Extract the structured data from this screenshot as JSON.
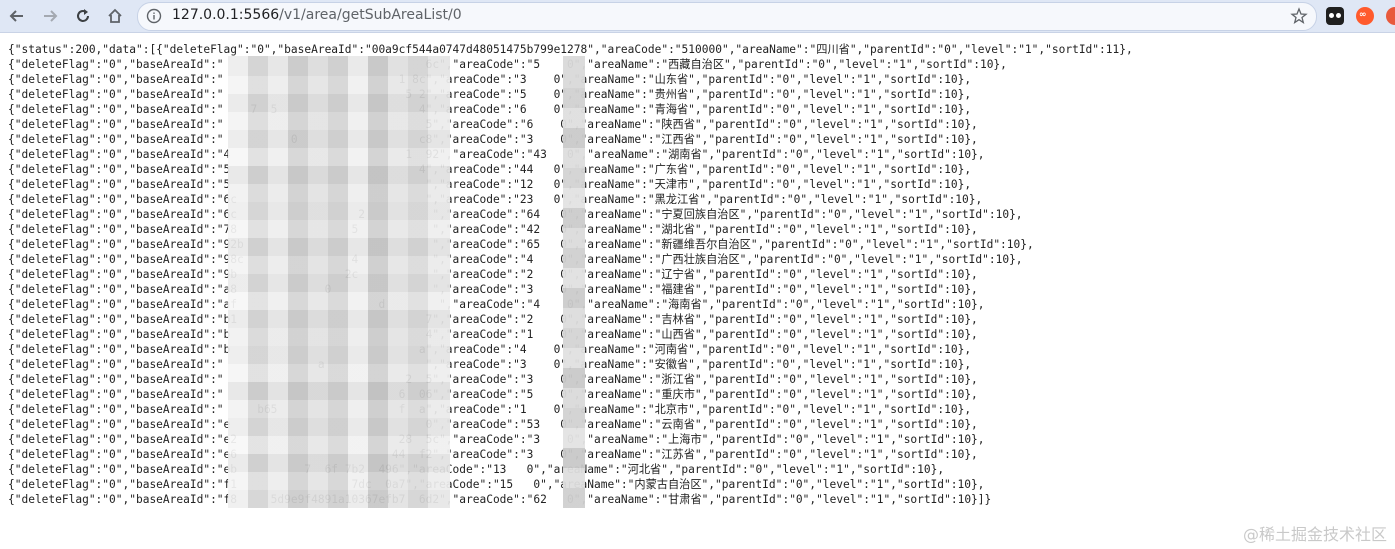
{
  "browser": {
    "url_host": "127.0.0.1:5566",
    "url_path": "/v1/area/getSubAreaList/0"
  },
  "response_lines": [
    "{\"status\":200,\"data\":[{\"deleteFlag\":\"0\",\"baseAreaId\":\"00a9cf544a0747d48051475b799e1278\",\"areaCode\":\"510000\",\"areaName\":\"四川省\",\"parentId\":\"0\",\"level\":\"1\",\"sortId\":11},",
    "{\"deleteFlag\":\"0\",\"baseAreaId\":\"                              6c\",\"areaCode\":\"5    0\",\"areaName\":\"西藏自治区\",\"parentId\":\"0\",\"level\":\"1\",\"sortId\":10},",
    "{\"deleteFlag\":\"0\",\"baseAreaId\":\"                          1 8c\",\"areaCode\":\"3    0\",\"areaName\":\"山东省\",\"parentId\":\"0\",\"level\":\"1\",\"sortId\":10},",
    "{\"deleteFlag\":\"0\",\"baseAreaId\":\"                           5 2\",\"areaCode\":\"5    0\",\"areaName\":\"贵州省\",\"parentId\":\"0\",\"level\":\"1\",\"sortId\":10},",
    "{\"deleteFlag\":\"0\",\"baseAreaId\":\"    7  5                     4\",\"areaCode\":\"6    0\",\"areaName\":\"青海省\",\"parentId\":\"0\",\"level\":\"1\",\"sortId\":10},",
    "{\"deleteFlag\":\"0\",\"baseAreaId\":\"                              5\",\"areaCode\":\"6    0\",\"areaName\":\"陕西省\",\"parentId\":\"0\",\"level\":\"1\",\"sortId\":10},",
    "{\"deleteFlag\":\"0\",\"baseAreaId\":\"          0                  c8\",\"areaCode\":\"3    0\",\"areaName\":\"江西省\",\"parentId\":\"0\",\"level\":\"1\",\"sortId\":10},",
    "{\"deleteFlag\":\"0\",\"baseAreaId\":\"4                          1  92\",\"areaCode\":\"43   0\",\"areaName\":\"湖南省\",\"parentId\":\"0\",\"level\":\"1\",\"sortId\":10},",
    "{\"deleteFlag\":\"0\",\"baseAreaId\":\"5                            4\",\"areaCode\":\"44   0\",\"areaName\":\"广东省\",\"parentId\":\"0\",\"level\":\"1\",\"sortId\":10},",
    "{\"deleteFlag\":\"0\",\"baseAreaId\":\"5                             \",\"areaCode\":\"12   0\",\"areaName\":\"天津市\",\"parentId\":\"0\",\"level\":\"1\",\"sortId\":10},",
    "{\"deleteFlag\":\"0\",\"baseAreaId\":\"6c                            \",\"areaCode\":\"23   0\",\"areaName\":\"黑龙江省\",\"parentId\":\"0\",\"level\":\"1\",\"sortId\":10},",
    "{\"deleteFlag\":\"0\",\"baseAreaId\":\"6c                  2          \",\"areaCode\":\"64   0\",\"areaName\":\"宁夏回族自治区\",\"parentId\":\"0\",\"level\":\"1\",\"sortId\":10},",
    "{\"deleteFlag\":\"0\",\"baseAreaId\":\"78                 5           \",\"areaCode\":\"42   0\",\"areaName\":\"湖北省\",\"parentId\":\"0\",\"level\":\"1\",\"sortId\":10},",
    "{\"deleteFlag\":\"0\",\"baseAreaId\":\"92b                            \",\"areaCode\":\"65   0\",\"areaName\":\"新疆维吾尔自治区\",\"parentId\":\"0\",\"level\":\"1\",\"sortId\":10},",
    "{\"deleteFlag\":\"0\",\"baseAreaId\":\"98c                4           \",\"areaCode\":\"4    0\",\"areaName\":\"广西壮族自治区\",\"parentId\":\"0\",\"level\":\"1\",\"sortId\":10},",
    "{\"deleteFlag\":\"0\",\"baseAreaId\":\"9b                2c           \",\"areaCode\":\"2    0\",\"areaName\":\"辽宁省\",\"parentId\":\"0\",\"level\":\"1\",\"sortId\":10},",
    "{\"deleteFlag\":\"0\",\"baseAreaId\":\"a8             0               \",\"areaCode\":\"3    0\",\"areaName\":\"福建省\",\"parentId\":\"0\",\"level\":\"1\",\"sortId\":10},",
    "{\"deleteFlag\":\"0\",\"baseAreaId\":\"af                     d        \",\"areaCode\":\"4    0\",\"areaName\":\"海南省\",\"parentId\":\"0\",\"level\":\"1\",\"sortId\":10},",
    "{\"deleteFlag\":\"0\",\"baseAreaId\":\"b1                            7\",\"areaCode\":\"2    0\",\"areaName\":\"吉林省\",\"parentId\":\"0\",\"level\":\"1\",\"sortId\":10},",
    "{\"deleteFlag\":\"0\",\"baseAreaId\":\"b                             4\",\"areaCode\":\"1    0\",\"areaName\":\"山西省\",\"parentId\":\"0\",\"level\":\"1\",\"sortId\":10},",
    "{\"deleteFlag\":\"0\",\"baseAreaId\":\"b                            a\",\"areaCode\":\"4    0\",\"areaName\":\"河南省\",\"parentId\":\"0\",\"level\":\"1\",\"sortId\":10},",
    "{\"deleteFlag\":\"0\",\"baseAreaId\":\"              a               \",\"areaCode\":\"3    0\",\"areaName\":\"安徽省\",\"parentId\":\"0\",\"level\":\"1\",\"sortId\":10},",
    "{\"deleteFlag\":\"0\",\"baseAreaId\":\"                           2  5\",\"areaCode\":\"3    0\",\"areaName\":\"浙江省\",\"parentId\":\"0\",\"level\":\"1\",\"sortId\":10},",
    "{\"deleteFlag\":\"0\",\"baseAreaId\":\"                          6  06\",\"areaCode\":\"5    0\",\"areaName\":\"重庆市\",\"parentId\":\"0\",\"level\":\"1\",\"sortId\":10},",
    "{\"deleteFlag\":\"0\",\"baseAreaId\":\"     b65                  f  a\",\"areaCode\":\"1    0\",\"areaName\":\"北京市\",\"parentId\":\"0\",\"level\":\"1\",\"sortId\":10},",
    "{\"deleteFlag\":\"0\",\"baseAreaId\":\"e                             0\",\"areaCode\":\"53   0\",\"areaName\":\"云南省\",\"parentId\":\"0\",\"level\":\"1\",\"sortId\":10},",
    "{\"deleteFlag\":\"0\",\"baseAreaId\":\"e2                        28  5c\",\"areaCode\":\"3    0\",\"areaName\":\"上海市\",\"parentId\":\"0\",\"level\":\"1\",\"sortId\":10},",
    "{\"deleteFlag\":\"0\",\"baseAreaId\":\"e6                       44  f2\",\"areaCode\":\"3    0\",\"areaName\":\"江苏省\",\"parentId\":\"0\",\"level\":\"1\",\"sortId\":10},",
    "{\"deleteFlag\":\"0\",\"baseAreaId\":\"eb          7  6f 7b2  496\",\"areaCode\":\"13   0\",\"areaName\":\"河北省\",\"parentId\":\"0\",\"level\":\"1\",\"sortId\":10},",
    "{\"deleteFlag\":\"0\",\"baseAreaId\":\"f1                 7dc  0a7\",\"areaCode\":\"15   0\",\"areaName\":\"内蒙古自治区\",\"parentId\":\"0\",\"level\":\"1\",\"sortId\":10},",
    "{\"deleteFlag\":\"0\",\"baseAreaId\":\"f8     5d9e9f4891a10367efb7  6d2\",\"areaCode\":\"62   0\",\"areaName\":\"甘肃省\",\"parentId\":\"0\",\"level\":\"1\",\"sortId\":10}]}"
  ],
  "watermark": "@稀土掘金技术社区"
}
